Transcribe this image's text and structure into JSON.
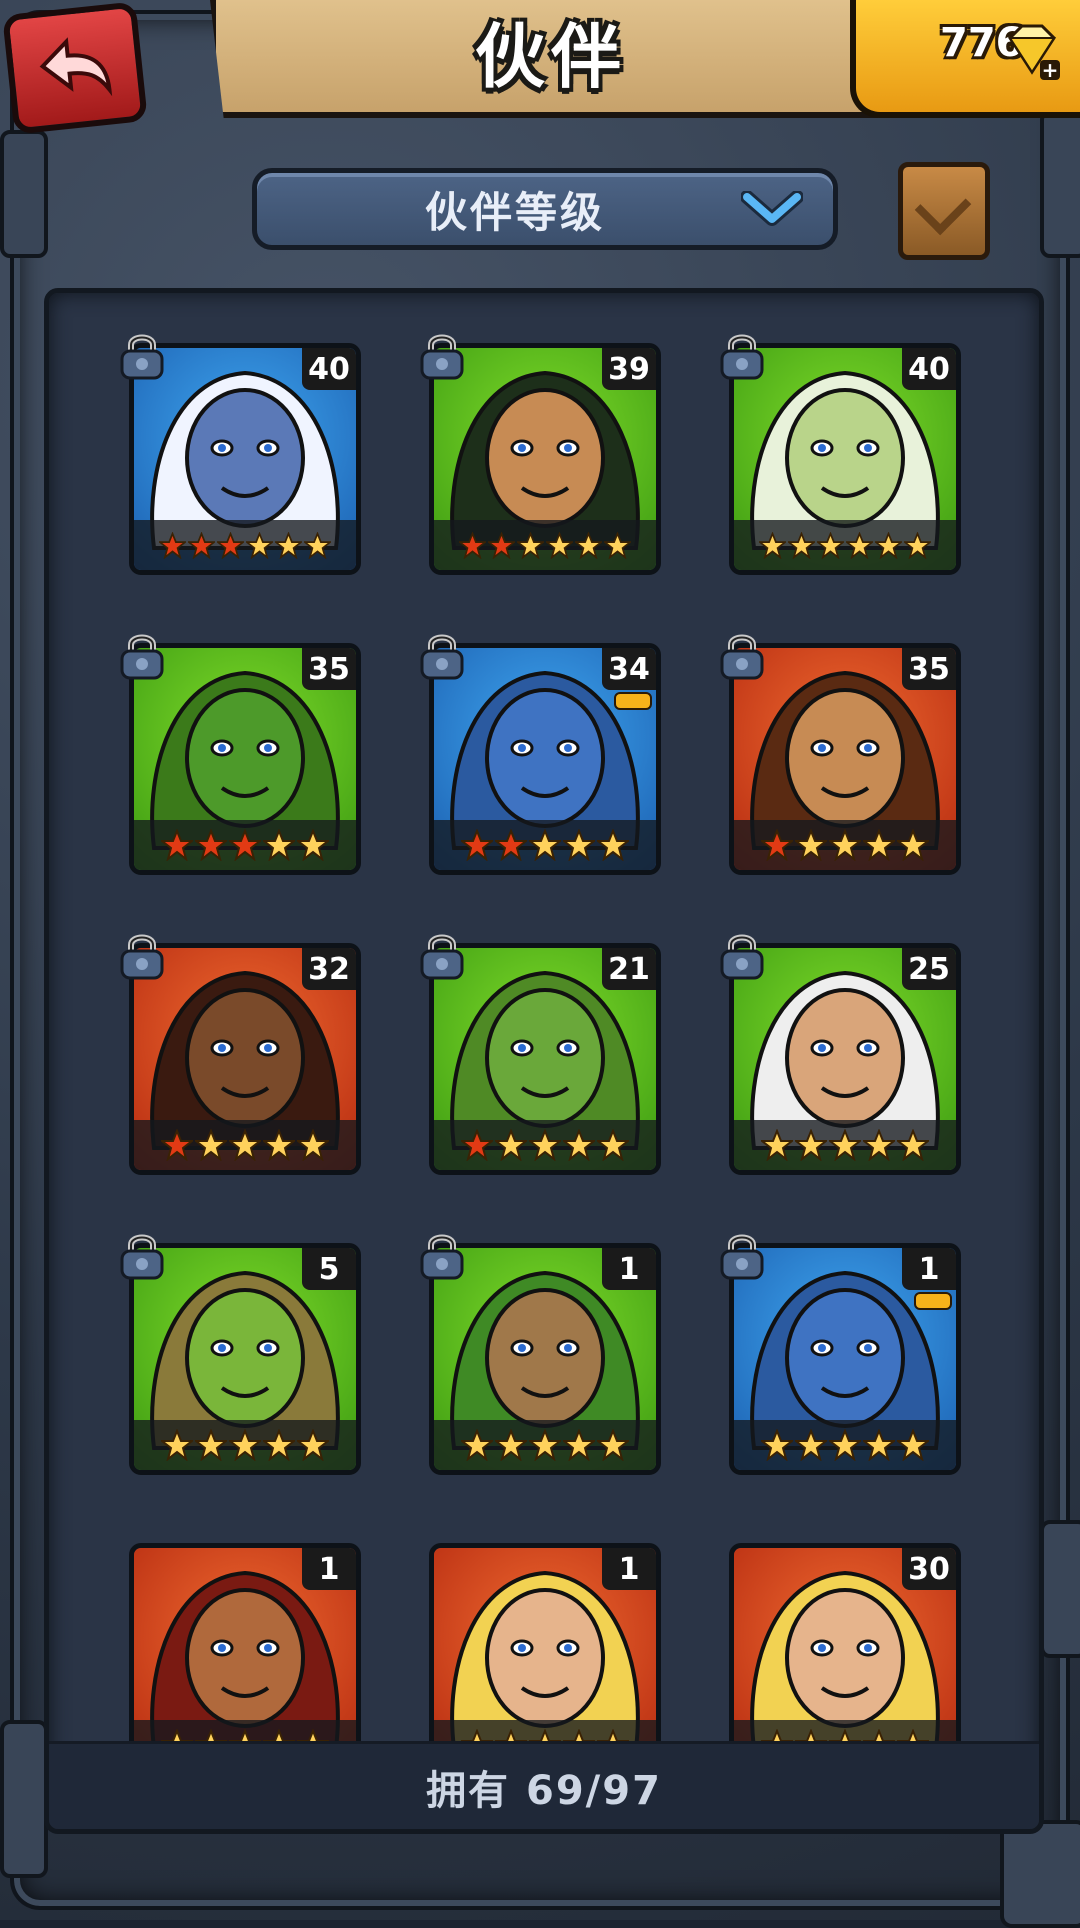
{
  "header": {
    "title": "伙伴",
    "gems": "776"
  },
  "sort": {
    "label": "伙伴等级"
  },
  "colors": {
    "blue": "#2f8fe0",
    "green": "#5fc21f",
    "red": "#e2451f",
    "star_gold": "#ffd25c",
    "star_red": "#e23a14"
  },
  "partners": [
    {
      "level": "40",
      "bg": "blue",
      "red_stars": 3,
      "total_stars": 6,
      "locked": true,
      "face": "#5b79b7",
      "hair": "#f0f4ff",
      "extra": ""
    },
    {
      "level": "39",
      "bg": "green",
      "red_stars": 2,
      "total_stars": 6,
      "locked": true,
      "face": "#c78b54",
      "hair": "#1d2f1a",
      "extra": ""
    },
    {
      "level": "40",
      "bg": "green",
      "red_stars": 0,
      "total_stars": 6,
      "locked": true,
      "face": "#b9d48a",
      "hair": "#e8f2da",
      "extra": ""
    },
    {
      "level": "35",
      "bg": "green",
      "red_stars": 3,
      "total_stars": 5,
      "locked": true,
      "face": "#4d9a2a",
      "hair": "#3b7a1a",
      "extra": ""
    },
    {
      "level": "34",
      "bg": "blue",
      "red_stars": 2,
      "total_stars": 5,
      "locked": true,
      "face": "#3f73c2",
      "hair": "#2b5aa0",
      "extra": "crown"
    },
    {
      "level": "35",
      "bg": "red",
      "red_stars": 1,
      "total_stars": 5,
      "locked": true,
      "face": "#c78b54",
      "hair": "#5a2a12",
      "extra": ""
    },
    {
      "level": "32",
      "bg": "red",
      "red_stars": 1,
      "total_stars": 5,
      "locked": true,
      "face": "#7a4a2a",
      "hair": "#3a1a10",
      "extra": ""
    },
    {
      "level": "21",
      "bg": "green",
      "red_stars": 1,
      "total_stars": 5,
      "locked": true,
      "face": "#6aa83a",
      "hair": "#4f8a25",
      "extra": ""
    },
    {
      "level": "25",
      "bg": "green",
      "red_stars": 0,
      "total_stars": 5,
      "locked": true,
      "face": "#d9a57a",
      "hair": "#eeeeee",
      "extra": ""
    },
    {
      "level": "5",
      "bg": "green",
      "red_stars": 0,
      "total_stars": 5,
      "locked": true,
      "face": "#7ab63a",
      "hair": "#8a7a3a",
      "extra": ""
    },
    {
      "level": "1",
      "bg": "green",
      "red_stars": 0,
      "total_stars": 5,
      "locked": true,
      "face": "#a0784a",
      "hair": "#3f8a25",
      "extra": ""
    },
    {
      "level": "1",
      "bg": "blue",
      "red_stars": 0,
      "total_stars": 5,
      "locked": true,
      "face": "#3f73c2",
      "hair": "#2b5aa0",
      "extra": "crown"
    },
    {
      "level": "1",
      "bg": "red",
      "red_stars": 0,
      "total_stars": 5,
      "locked": false,
      "face": "#b0693c",
      "hair": "#7a1a12",
      "extra": ""
    },
    {
      "level": "1",
      "bg": "red",
      "red_stars": 0,
      "total_stars": 5,
      "locked": false,
      "face": "#e6b48c",
      "hair": "#f2d252",
      "extra": ""
    },
    {
      "level": "30",
      "bg": "red",
      "red_stars": 0,
      "total_stars": 5,
      "locked": false,
      "face": "#e6b48c",
      "hair": "#f2d252",
      "extra": ""
    }
  ],
  "footer": {
    "owned": "拥有 69/97"
  }
}
